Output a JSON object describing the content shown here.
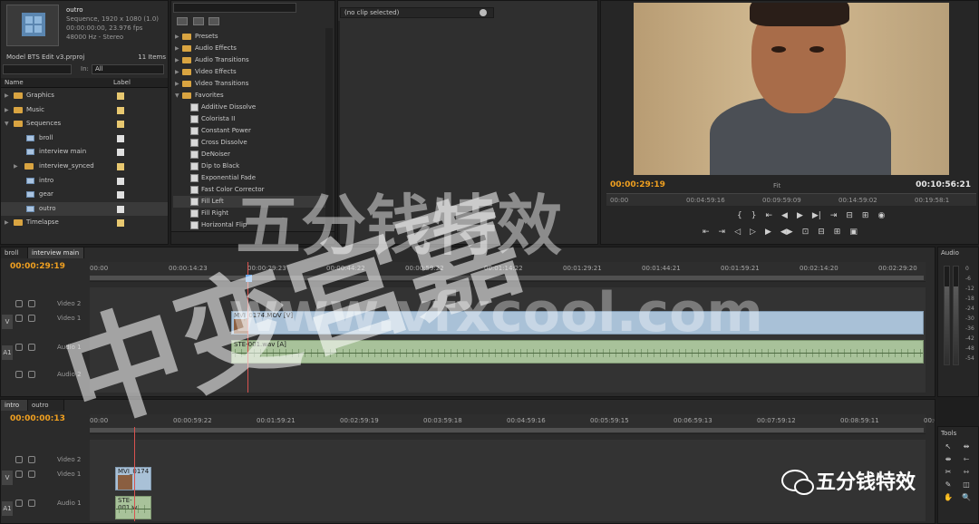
{
  "project": {
    "seq_name": "outro",
    "seq_line1": "Sequence, 1920 x 1080 (1.0)",
    "seq_line2": "00:00:00:00, 23.976 fps",
    "seq_line3": "48000 Hz - Stereo",
    "project_file": "Model BTS Edit v3.prproj",
    "items_count": "11 Items",
    "in_label": "In:",
    "in_value": "All",
    "col_name": "Name",
    "col_label": "Label",
    "bins": [
      {
        "label": "Graphics",
        "color": "#e8c870"
      },
      {
        "label": "Music",
        "color": "#e8c870"
      },
      {
        "label": "Sequences",
        "color": "#e8c870"
      },
      {
        "label": "broll",
        "color": "#e0e0e0"
      },
      {
        "label": "interview main",
        "color": "#e0e0e0"
      },
      {
        "label": "interview_synced",
        "color": "#e8c870"
      },
      {
        "label": "intro",
        "color": "#e0e0e0"
      },
      {
        "label": "gear",
        "color": "#e0e0e0"
      },
      {
        "label": "outro",
        "color": "#e0e0e0"
      },
      {
        "label": "Timelapse",
        "color": "#e8c870"
      }
    ]
  },
  "effects": {
    "folders": [
      "Presets",
      "Audio Effects",
      "Audio Transitions",
      "Video Effects",
      "Video Transitions",
      "Favorites"
    ],
    "favorites": [
      "Additive Dissolve",
      "Colorista II",
      "Constant Power",
      "Cross Dissolve",
      "DeNoiser",
      "Dip to Black",
      "Exponential Fade",
      "Fast Color Corrector",
      "Fill Left",
      "Fill Right",
      "Horizontal Flip"
    ]
  },
  "source": {
    "no_clip": "(no clip selected)"
  },
  "program": {
    "tc_left": "00:00:29:19",
    "tc_right": "00:10:56:21",
    "fit": "Fit",
    "ruler": [
      "00:00",
      "00:04:59:16",
      "00:09:59:09",
      "00:14:59:02",
      "00:19:58:1"
    ],
    "transport_row1": [
      "{",
      "}",
      "⇤",
      "◀",
      "▶",
      "▶|",
      "⇥",
      "⊟",
      "⊞",
      "◉"
    ],
    "transport_row2": [
      "⇤",
      "⇥",
      "◁",
      "▷",
      "▶",
      "◀▶",
      "⊡",
      "⊟",
      "⊞",
      "▣"
    ]
  },
  "timeline1": {
    "tabs": [
      "broll",
      "interview main"
    ],
    "timecode": "00:00:29:19",
    "ruler": [
      "00:00",
      "00:00:14:23",
      "00:00:29:23",
      "00:00:44:22",
      "00:00:59:22",
      "00:01:14:22",
      "00:01:29:21",
      "00:01:44:21",
      "00:01:59:21",
      "00:02:14:20",
      "00:02:29:20"
    ],
    "tracks": [
      {
        "side": "",
        "name": "Video 2"
      },
      {
        "side": "V",
        "name": "Video 1"
      },
      {
        "side": "A1",
        "name": "Audio 1"
      },
      {
        "side": "",
        "name": "Audio 2"
      }
    ],
    "video_clip": "MVI_0174.MOV [V]",
    "audio_clip": "STE-001.wav [A]"
  },
  "timeline2": {
    "tabs": [
      "intro",
      "outro"
    ],
    "timecode": "00:00:00:13",
    "ruler": [
      "00:00",
      "00:00:59:22",
      "00:01:59:21",
      "00:02:59:19",
      "00:03:59:18",
      "00:04:59:16",
      "00:05:59:15",
      "00:06:59:13",
      "00:07:59:12",
      "00:08:59:11",
      "00:09"
    ],
    "tracks": [
      {
        "side": "",
        "name": "Video 2"
      },
      {
        "side": "V",
        "name": "Video 1"
      },
      {
        "side": "A1",
        "name": "Audio 1"
      }
    ],
    "video_clip": "MVI_0174",
    "audio_clip": "STE-001.w"
  },
  "audio_panel": {
    "title": "Audio",
    "db": [
      "0",
      "-6",
      "-12",
      "-18",
      "-24",
      "-30",
      "-36",
      "-42",
      "-48",
      "-54"
    ]
  },
  "tools": {
    "title": "Tools",
    "icons": [
      "↖",
      "⇹",
      "⇼",
      "⇽",
      "✂",
      "⇿",
      "✎",
      "◫",
      "✋",
      "🔍"
    ]
  },
  "watermarks": {
    "cn1": "中变宫嘉",
    "cn2": "五分钱特效",
    "url": "www.vfxcool.com",
    "wechat": "五分钱特效"
  }
}
